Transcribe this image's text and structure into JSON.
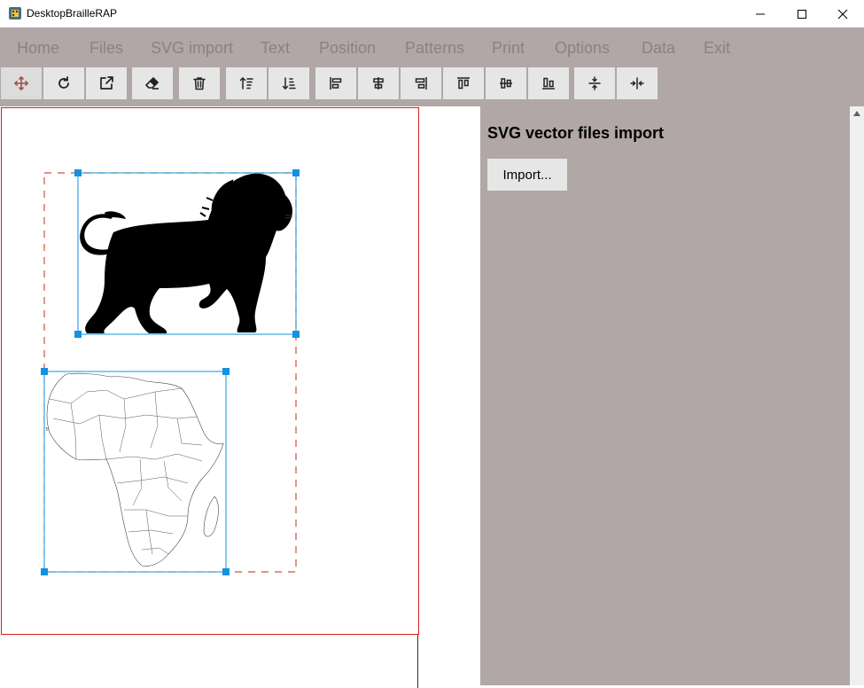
{
  "window": {
    "title": "DesktopBrailleRAP",
    "controls": [
      "minimize-icon",
      "maximize-icon",
      "close-icon"
    ]
  },
  "menu": {
    "items": [
      "Home",
      "Files",
      "SVG import",
      "Text",
      "Position",
      "Patterns",
      "Print",
      "Options",
      "Data",
      "Exit"
    ]
  },
  "toolbar": {
    "buttons": [
      {
        "icon": "move-icon"
      },
      {
        "icon": "rotate-icon"
      },
      {
        "icon": "open-external-icon"
      },
      {
        "icon": "eraser-icon"
      },
      {
        "icon": "trash-icon"
      },
      {
        "icon": "sort-ascending-icon"
      },
      {
        "icon": "sort-descending-icon"
      },
      {
        "icon": "align-left-icon"
      },
      {
        "icon": "align-center-horizontal-icon"
      },
      {
        "icon": "align-right-icon"
      },
      {
        "icon": "align-top-icon"
      },
      {
        "icon": "align-center-vertical-icon"
      },
      {
        "icon": "align-bottom-icon"
      },
      {
        "icon": "distribute-vertical-icon"
      },
      {
        "icon": "distribute-horizontal-icon"
      }
    ]
  },
  "canvas": {
    "objects": [
      "lion-silhouette",
      "africa-map"
    ]
  },
  "panel": {
    "title": "SVG vector files import",
    "import_label": "Import..."
  },
  "colors": {
    "panel_bg": "#b0a7a6",
    "menu_text": "#8a8281",
    "page_border": "#d81e1e",
    "selection": "#1492e0",
    "button_bg": "#e6e6e6"
  }
}
